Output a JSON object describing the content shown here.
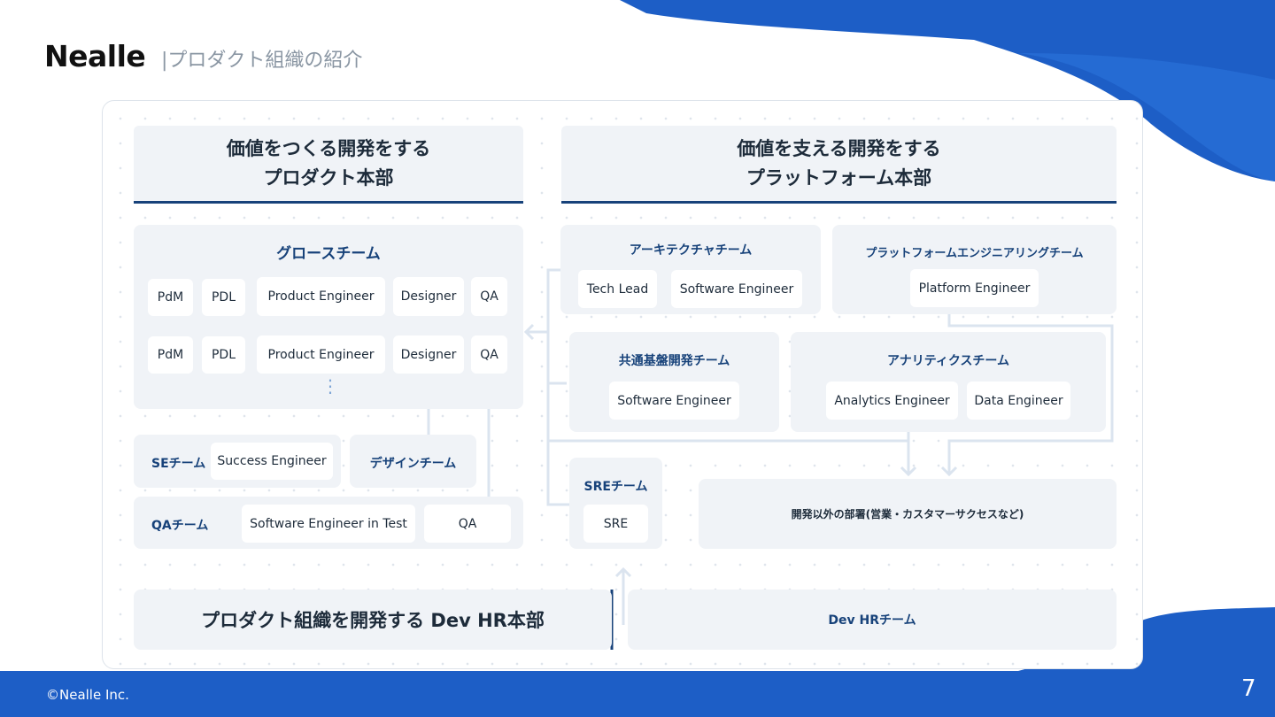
{
  "header": {
    "logo": "Nealle",
    "title": "|プロダクト組織の紹介"
  },
  "product_division": {
    "title_line1": "価値をつくる開発をする",
    "title_line2": "プロダクト本部"
  },
  "platform_division": {
    "title_line1": "価値を支える開発をする",
    "title_line2": "プラットフォーム本部"
  },
  "growth_team": {
    "name": "グロースチーム",
    "rows": [
      [
        "PdM",
        "PDL",
        "Product Engineer",
        "Designer",
        "QA"
      ],
      [
        "PdM",
        "PDL",
        "Product Engineer",
        "Designer",
        "QA"
      ]
    ],
    "more": "⋮"
  },
  "se_team": {
    "name": "SEチーム",
    "member": "Success Engineer"
  },
  "design_team": {
    "name": "デザインチーム"
  },
  "qa_team": {
    "name": "QAチーム",
    "members": [
      "Software Engineer in Test",
      "QA"
    ]
  },
  "architecture_team": {
    "name": "アーキテクチャチーム",
    "members": [
      "Tech Lead",
      "Software Engineer"
    ]
  },
  "platform_eng_team": {
    "name": "プラットフォームエンジニアリングチーム",
    "member": "Platform Engineer"
  },
  "common_base_team": {
    "name": "共通基盤開発チーム",
    "member": "Software Engineer"
  },
  "analytics_team": {
    "name": "アナリティクスチーム",
    "members": [
      "Analytics Engineer",
      "Data Engineer"
    ]
  },
  "sre_team": {
    "name": "SREチーム",
    "member": "SRE"
  },
  "other_depts": {
    "label": "開発以外の部署(営業・カスタマーサクセスなど)"
  },
  "devhr_division": {
    "title": "プロダクト組織を開発する Dev HR本部"
  },
  "devhr_team": {
    "name": "Dev HRチーム"
  },
  "footer": {
    "copyright": "©Nealle Inc.",
    "page": "7"
  },
  "colors": {
    "navy": "#17427a",
    "brand_blue": "#1c5fc4",
    "box_bg": "#f0f3f7",
    "connector": "#dbe4ef"
  }
}
